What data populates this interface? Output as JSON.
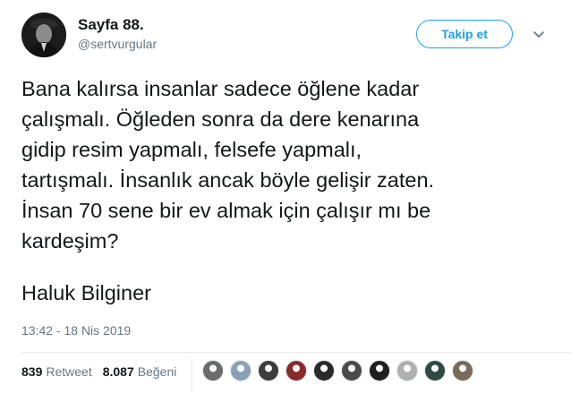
{
  "user": {
    "display_name": "Sayfa 88.",
    "handle": "@sertvurgular"
  },
  "follow_label": "Takip et",
  "tweet_lines": [
    "Bana kalırsa insanlar sadece öğlene kadar",
    "çalışmalı. Öğleden sonra da dere kenarına",
    "gidip resim yapmalı, felsefe yapmalı,",
    "tartışmalı. İnsanlık ancak böyle gelişir zaten.",
    "İnsan 70 sene bir ev almak için çalışır mı be",
    "kardeşim?"
  ],
  "signature": "Haluk Bilginer",
  "timestamp": "13:42 - 18 Nis 2019",
  "stats": {
    "retweet_count": "839",
    "retweet_label": "Retweet",
    "like_count": "8.087",
    "like_label": "Beğeni"
  },
  "liker_avatars": [
    {
      "icon": "avatar-icon",
      "color": "#6b6b6b"
    },
    {
      "icon": "default-egg-avatar-icon",
      "color": "#8aa0b4"
    },
    {
      "icon": "avatar-icon",
      "color": "#3c3c3c"
    },
    {
      "icon": "avatar-icon",
      "color": "#8b2a2a"
    },
    {
      "icon": "avatar-icon",
      "color": "#2a2a2a"
    },
    {
      "icon": "avatar-icon",
      "color": "#4a4a4a"
    },
    {
      "icon": "avatar-icon",
      "color": "#1e1e1e"
    },
    {
      "icon": "avatar-icon",
      "color": "#b0b0b0"
    },
    {
      "icon": "avatar-icon",
      "color": "#2e4a44"
    },
    {
      "icon": "avatar-icon",
      "color": "#7a6a5a"
    }
  ],
  "colors": {
    "accent": "#1da1f2",
    "muted": "#657786",
    "text": "#14171a"
  }
}
